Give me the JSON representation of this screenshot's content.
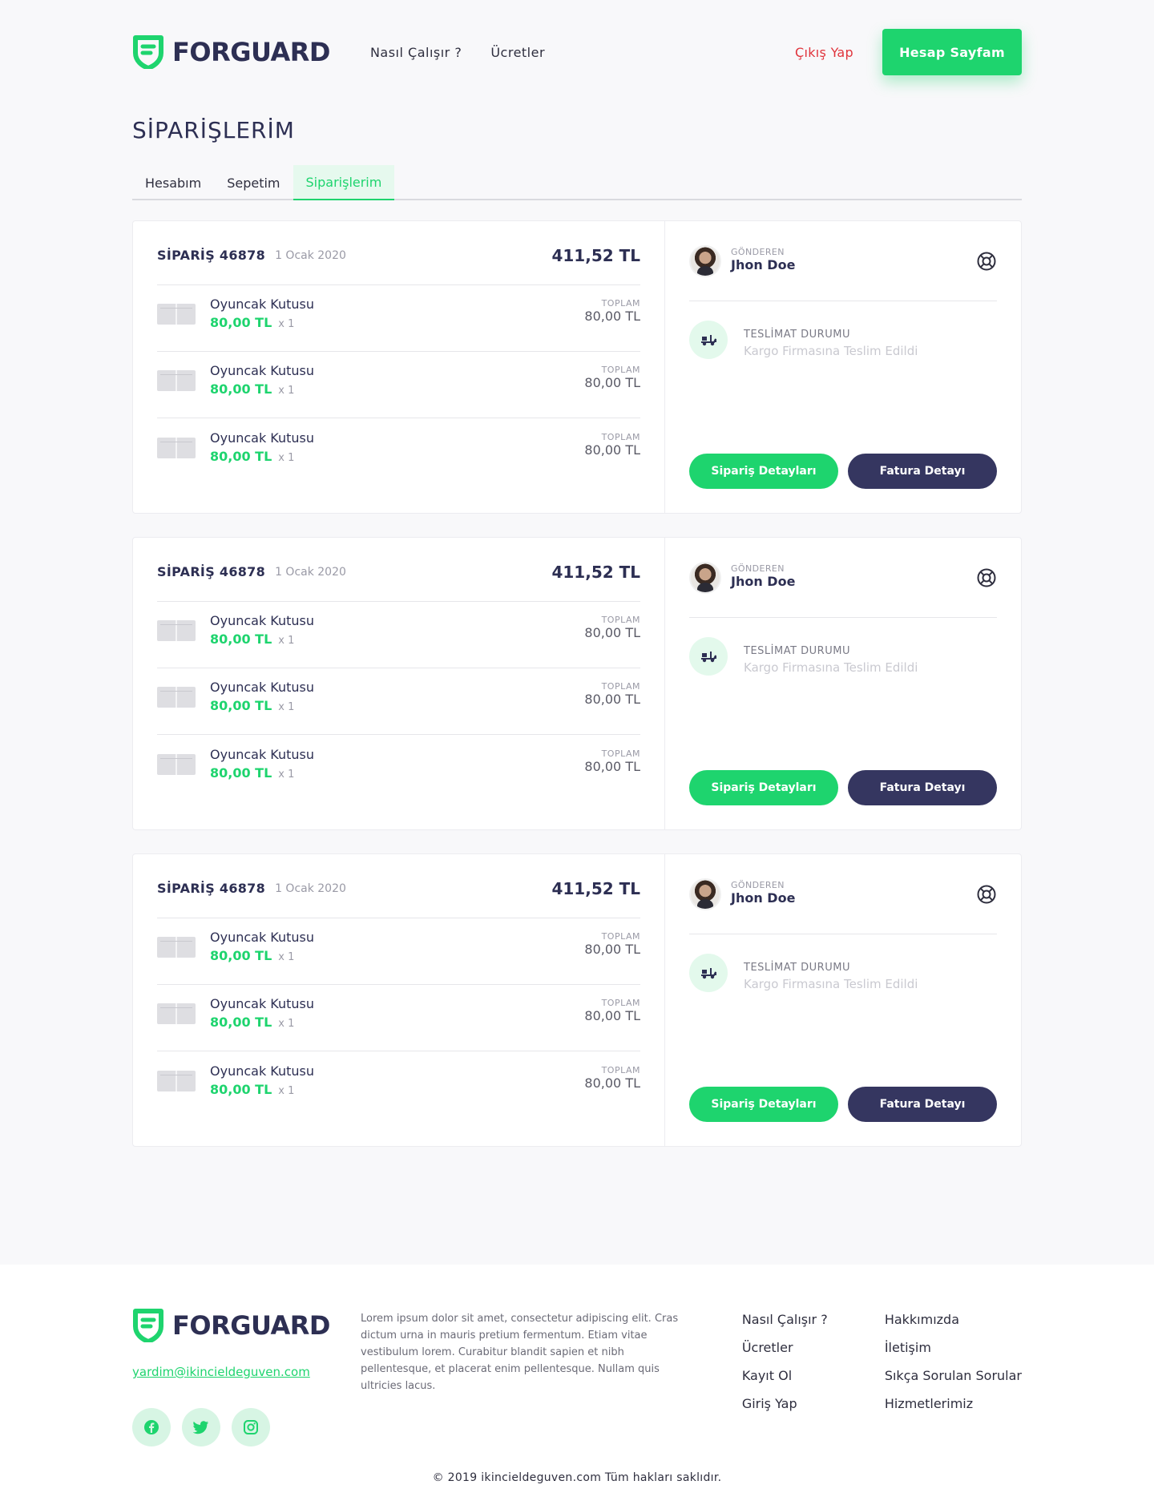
{
  "header": {
    "logo_text_a": "FOR",
    "logo_text_b": "GUARD",
    "nav": [
      "Nasıl Çalışır ?",
      "Ücretler"
    ],
    "logout": "Çıkış Yap",
    "account_button": "Hesap Sayfam"
  },
  "page_title": "SİPARİŞLERİM",
  "tabs": [
    "Hesabım",
    "Sepetim",
    "Siparişlerim"
  ],
  "active_tab": "Siparişlerim",
  "orders": [
    {
      "number": "SİPARİŞ 46878",
      "date": "1 Ocak 2020",
      "total": "411,52 TL",
      "items": [
        {
          "name": "Oyuncak Kutusu",
          "price": "80,00 TL",
          "qty": "x 1",
          "total_label": "TOPLAM",
          "total": "80,00 TL"
        },
        {
          "name": "Oyuncak Kutusu",
          "price": "80,00 TL",
          "qty": "x 1",
          "total_label": "TOPLAM",
          "total": "80,00 TL"
        },
        {
          "name": "Oyuncak Kutusu",
          "price": "80,00 TL",
          "qty": "x 1",
          "total_label": "TOPLAM",
          "total": "80,00 TL"
        }
      ],
      "sender_label": "GÖNDEREN",
      "sender_name": "Jhon Doe",
      "delivery_label": "TESLİMAT DURUMU",
      "delivery_status": "Kargo Firmasına Teslim Edildi",
      "details_button": "Sipariş Detayları",
      "invoice_button": "Fatura Detayı"
    },
    {
      "number": "SİPARİŞ 46878",
      "date": "1 Ocak 2020",
      "total": "411,52 TL",
      "items": [
        {
          "name": "Oyuncak Kutusu",
          "price": "80,00 TL",
          "qty": "x 1",
          "total_label": "TOPLAM",
          "total": "80,00 TL"
        },
        {
          "name": "Oyuncak Kutusu",
          "price": "80,00 TL",
          "qty": "x 1",
          "total_label": "TOPLAM",
          "total": "80,00 TL"
        },
        {
          "name": "Oyuncak Kutusu",
          "price": "80,00 TL",
          "qty": "x 1",
          "total_label": "TOPLAM",
          "total": "80,00 TL"
        }
      ],
      "sender_label": "GÖNDEREN",
      "sender_name": "Jhon Doe",
      "delivery_label": "TESLİMAT DURUMU",
      "delivery_status": "Kargo Firmasına Teslim Edildi",
      "details_button": "Sipariş Detayları",
      "invoice_button": "Fatura Detayı"
    },
    {
      "number": "SİPARİŞ 46878",
      "date": "1 Ocak 2020",
      "total": "411,52 TL",
      "items": [
        {
          "name": "Oyuncak Kutusu",
          "price": "80,00 TL",
          "qty": "x 1",
          "total_label": "TOPLAM",
          "total": "80,00 TL"
        },
        {
          "name": "Oyuncak Kutusu",
          "price": "80,00 TL",
          "qty": "x 1",
          "total_label": "TOPLAM",
          "total": "80,00 TL"
        },
        {
          "name": "Oyuncak Kutusu",
          "price": "80,00 TL",
          "qty": "x 1",
          "total_label": "TOPLAM",
          "total": "80,00 TL"
        }
      ],
      "sender_label": "GÖNDEREN",
      "sender_name": "Jhon Doe",
      "delivery_label": "TESLİMAT DURUMU",
      "delivery_status": "Kargo Firmasına Teslim Edildi",
      "details_button": "Sipariş Detayları",
      "invoice_button": "Fatura Detayı"
    }
  ],
  "footer": {
    "email": "yardim@ikincieldeguven.com",
    "description": "Lorem ipsum dolor sit amet, consectetur adipiscing elit. Cras dictum urna in mauris pretium fermentum. Etiam vitae vestibulum lorem. Curabitur blandit sapien et nibh pellentesque, et placerat enim pellentesque. Nullam quis ultricies lacus.",
    "socials": [
      "facebook-icon",
      "twitter-icon",
      "instagram-icon"
    ],
    "links_col1": [
      "Nasıl Çalışır ?",
      "Ücretler",
      "Kayıt Ol",
      "Giriş Yap"
    ],
    "links_col2": [
      "Hakkımızda",
      "İletişim",
      "Sıkça Sorulan Sorular",
      "Hizmetlerimiz"
    ],
    "copyright": "© 2019 ikincieldeguven.com Tüm hakları saklıdır."
  },
  "colors": {
    "accent": "#1ed46e",
    "dark": "#353660",
    "danger": "#e0343c"
  }
}
